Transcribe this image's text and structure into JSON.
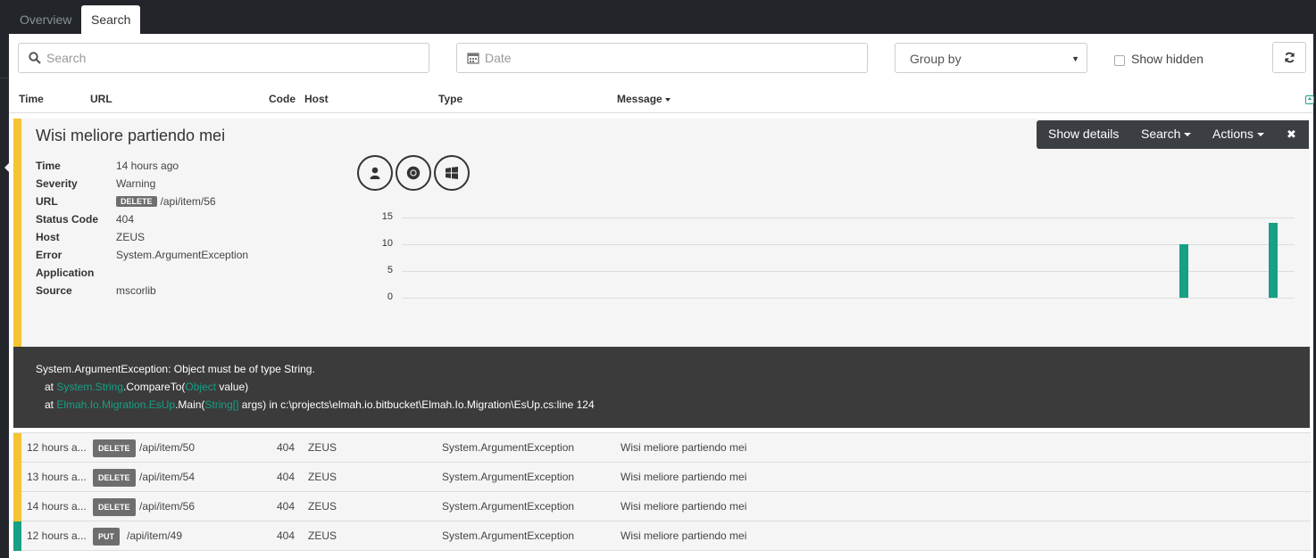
{
  "tabs": [
    {
      "label": "Overview",
      "active": false
    },
    {
      "label": "Search",
      "active": true
    }
  ],
  "filters": {
    "search_placeholder": "Search",
    "date_placeholder": "Date",
    "group_by": "Group by",
    "show_hidden_label": "Show hidden",
    "show_hidden_checked": false
  },
  "columns": [
    "Time",
    "URL",
    "Code",
    "Host",
    "Type",
    "Message"
  ],
  "sorted_column": "Message",
  "detail": {
    "title": "Wisi meliore partiendo mei",
    "toolbar": {
      "show_details": "Show details",
      "search": "Search",
      "actions": "Actions",
      "close": "✖"
    },
    "fields": [
      {
        "key": "Time",
        "value": "14 hours ago"
      },
      {
        "key": "Severity",
        "value": "Warning"
      },
      {
        "key": "URL",
        "method": "DELETE",
        "value": "/api/item/56"
      },
      {
        "key": "Status Code",
        "value": "404"
      },
      {
        "key": "Host",
        "value": "ZEUS"
      },
      {
        "key": "Error",
        "value": "System.ArgumentException"
      },
      {
        "key": "Application",
        "value": ""
      },
      {
        "key": "Source",
        "value": "mscorlib"
      }
    ],
    "icons": [
      "user-icon",
      "chrome-icon",
      "windows-icon"
    ],
    "severity_color": "#f6c431",
    "stacktrace": {
      "line1": "System.ArgumentException: Object must be of type String.",
      "line2_prefix": "   at ",
      "line2_type": "System.String",
      "line2_method": ".CompareTo(",
      "line2_arg_type": "Object",
      "line2_rest": " value)",
      "line3_prefix": "   at ",
      "line3_type": "Elmah.Io.Migration.EsUp",
      "line3_method": ".Main(",
      "line3_arg_type": "String[]",
      "line3_rest": " args) in c:\\projects\\elmah.io.bitbucket\\Elmah.Io.Migration\\EsUp.cs:line 124"
    }
  },
  "chart_data": {
    "type": "bar",
    "title": "",
    "xlabel": "",
    "ylabel": "",
    "ylim": [
      0,
      15
    ],
    "yticks": [
      0,
      5,
      10,
      15
    ],
    "grid": true,
    "bar_color": "#16a085",
    "categories_count": 100,
    "points": [
      {
        "index": 87,
        "value": 10
      },
      {
        "index": 97,
        "value": 14
      }
    ]
  },
  "rows": [
    {
      "time": "12 hours a...",
      "method": "DELETE",
      "url": "/api/item/50",
      "code": "404",
      "host": "ZEUS",
      "type": "System.ArgumentException",
      "message": "Wisi meliore partiendo mei",
      "color": "#f6c431"
    },
    {
      "time": "13 hours a...",
      "method": "DELETE",
      "url": "/api/item/54",
      "code": "404",
      "host": "ZEUS",
      "type": "System.ArgumentException",
      "message": "Wisi meliore partiendo mei",
      "color": "#f6c431"
    },
    {
      "time": "14 hours a...",
      "method": "DELETE",
      "url": "/api/item/56",
      "code": "404",
      "host": "ZEUS",
      "type": "System.ArgumentException",
      "message": "Wisi meliore partiendo mei",
      "color": "#f6c431"
    },
    {
      "time": "12 hours a...",
      "method": "PUT",
      "url": "/api/item/49",
      "code": "404",
      "host": "ZEUS",
      "type": "System.ArgumentException",
      "message": "Wisi meliore partiendo mei",
      "color": "#16a085"
    }
  ]
}
